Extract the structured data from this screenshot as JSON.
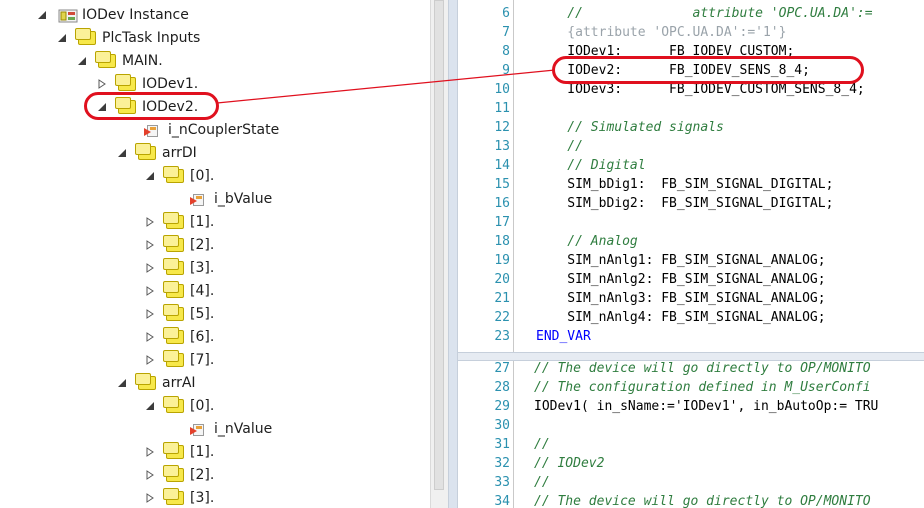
{
  "tree": {
    "nodes": [
      {
        "label": "IODev Instance",
        "expanded": true,
        "icon": "device-icon"
      },
      {
        "label": "PlcTask Inputs",
        "expanded": true,
        "icon": "folder-icon"
      },
      {
        "label": "MAIN.",
        "expanded": true,
        "icon": "folder-icon"
      },
      {
        "label": "IODev1.",
        "expanded": false,
        "icon": "folder-icon"
      },
      {
        "label": "IODev2.",
        "expanded": true,
        "icon": "folder-icon"
      },
      {
        "label": "i_nCouplerState",
        "expanded": null,
        "icon": "input-variable-icon"
      },
      {
        "label": "arrDI",
        "expanded": true,
        "icon": "folder-icon"
      },
      {
        "label": "[0].",
        "expanded": true,
        "icon": "folder-icon"
      },
      {
        "label": "i_bValue",
        "expanded": null,
        "icon": "input-variable-icon"
      },
      {
        "label": "[1].",
        "expanded": false,
        "icon": "folder-icon"
      },
      {
        "label": "[2].",
        "expanded": false,
        "icon": "folder-icon"
      },
      {
        "label": "[3].",
        "expanded": false,
        "icon": "folder-icon"
      },
      {
        "label": "[4].",
        "expanded": false,
        "icon": "folder-icon"
      },
      {
        "label": "[5].",
        "expanded": false,
        "icon": "folder-icon"
      },
      {
        "label": "[6].",
        "expanded": false,
        "icon": "folder-icon"
      },
      {
        "label": "[7].",
        "expanded": false,
        "icon": "folder-icon"
      },
      {
        "label": "arrAI",
        "expanded": true,
        "icon": "folder-icon"
      },
      {
        "label": "[0].",
        "expanded": true,
        "icon": "folder-icon"
      },
      {
        "label": "i_nValue",
        "expanded": null,
        "icon": "input-variable-icon"
      },
      {
        "label": "[1].",
        "expanded": false,
        "icon": "folder-icon"
      },
      {
        "label": "[2].",
        "expanded": false,
        "icon": "folder-icon"
      },
      {
        "label": "[3].",
        "expanded": false,
        "icon": "folder-icon"
      }
    ]
  },
  "editor": {
    "top_lines": [
      {
        "n": "6",
        "text": "    //              attribute 'OPC.UA.DA':=",
        "style": "cm"
      },
      {
        "n": "7",
        "text": "    {attribute 'OPC.UA.DA':='1'}",
        "style": "cm2"
      },
      {
        "n": "8",
        "text": "    IODev1:      FB_IODEV_CUSTOM;",
        "style": ""
      },
      {
        "n": "9",
        "text": "    IODev2:      FB_IODEV_SENS_8_4;",
        "style": ""
      },
      {
        "n": "10",
        "text": "    IODev3:      FB_IODEV_CUSTOM_SENS_8_4;",
        "style": ""
      },
      {
        "n": "11",
        "text": "",
        "style": ""
      },
      {
        "n": "12",
        "text": "    // Simulated signals",
        "style": "cm"
      },
      {
        "n": "13",
        "text": "    //",
        "style": "cm"
      },
      {
        "n": "14",
        "text": "    // Digital",
        "style": "cm"
      },
      {
        "n": "15",
        "text": "    SIM_bDig1:  FB_SIM_SIGNAL_DIGITAL;",
        "style": ""
      },
      {
        "n": "16",
        "text": "    SIM_bDig2:  FB_SIM_SIGNAL_DIGITAL;",
        "style": ""
      },
      {
        "n": "17",
        "text": "",
        "style": ""
      },
      {
        "n": "18",
        "text": "    // Analog",
        "style": "cm"
      },
      {
        "n": "19",
        "text": "    SIM_nAnlg1: FB_SIM_SIGNAL_ANALOG;",
        "style": ""
      },
      {
        "n": "20",
        "text": "    SIM_nAnlg2: FB_SIM_SIGNAL_ANALOG;",
        "style": ""
      },
      {
        "n": "21",
        "text": "    SIM_nAnlg3: FB_SIM_SIGNAL_ANALOG;",
        "style": ""
      },
      {
        "n": "22",
        "text": "    SIM_nAnlg4: FB_SIM_SIGNAL_ANALOG;",
        "style": ""
      },
      {
        "n": "23",
        "text": "END_VAR",
        "style": "kw"
      }
    ],
    "bottom_lines": [
      {
        "n": "27",
        "text": "// The device will go directly to OP/MONITO",
        "style": "cm"
      },
      {
        "n": "28",
        "text": "// The configuration defined in M_UserConfi",
        "style": "cm"
      },
      {
        "n": "29",
        "text": "IODev1( in_sName:='IODev1', in_bAutoOp:= TRU",
        "style": ""
      },
      {
        "n": "30",
        "text": "",
        "style": ""
      },
      {
        "n": "31",
        "text": "//",
        "style": "cm"
      },
      {
        "n": "32",
        "text": "// IODev2",
        "style": "cm"
      },
      {
        "n": "33",
        "text": "//",
        "style": "cm"
      },
      {
        "n": "34",
        "text": "// The device will go directly to OP/MONITO",
        "style": "cm"
      }
    ]
  },
  "colors": {
    "highlight": "#e0101e",
    "comment": "#2f7d3f",
    "line_number": "#2b91af",
    "keyword": "#0000ff"
  }
}
